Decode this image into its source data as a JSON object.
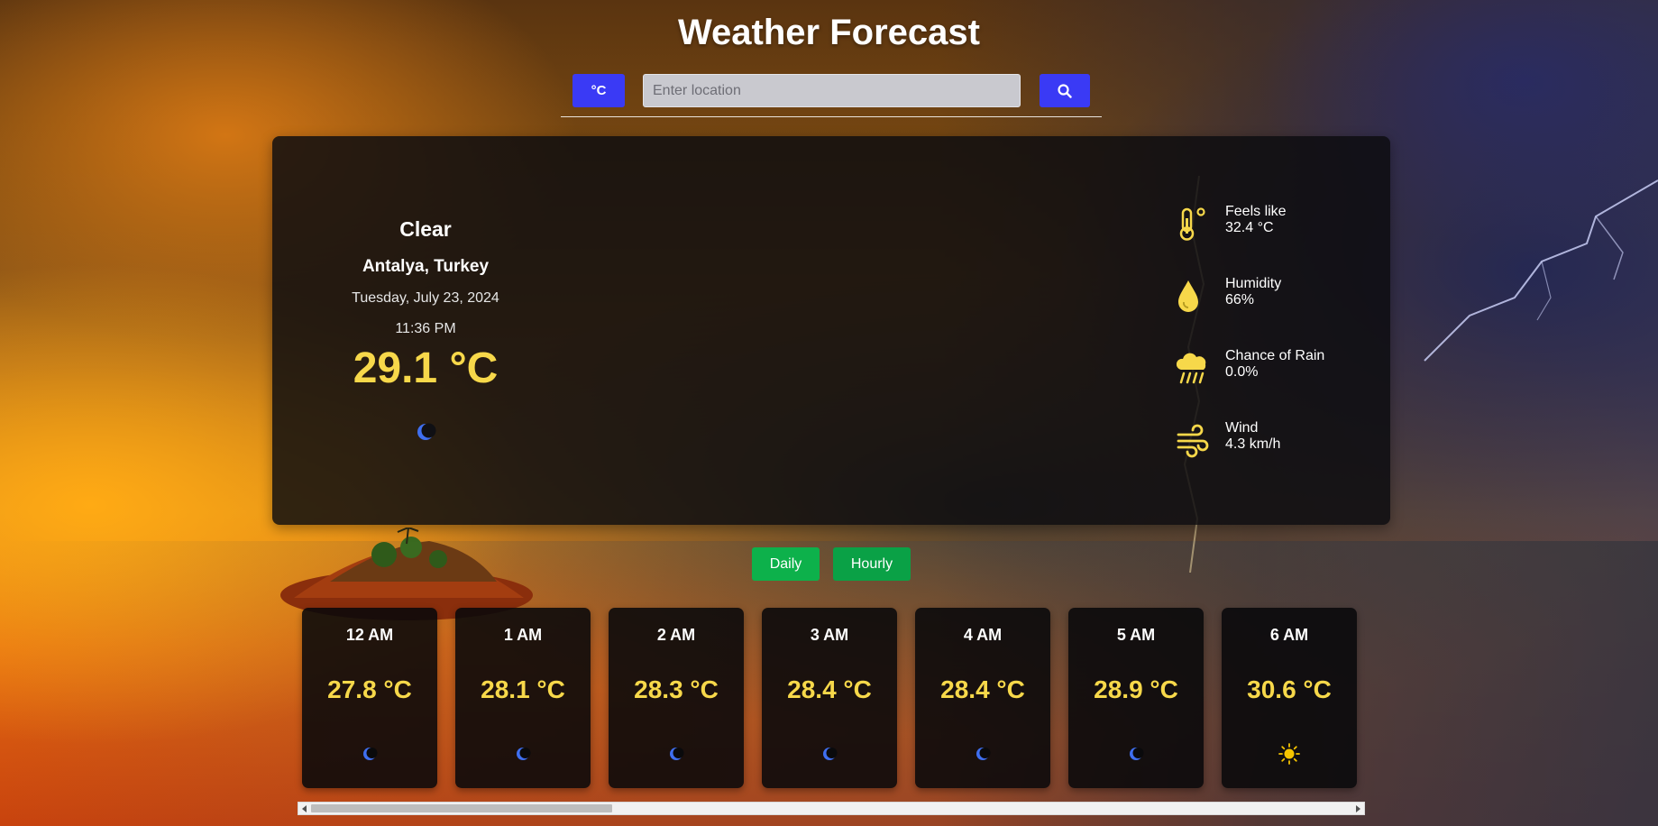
{
  "app": {
    "title": "Weather Forecast"
  },
  "search": {
    "unit_label": "°C",
    "placeholder": "Enter location",
    "value": "",
    "button_icon": "search-icon",
    "accent_color": "#3a3af5"
  },
  "current": {
    "condition": "Clear",
    "location": "Antalya, Turkey",
    "date": "Tuesday, July 23, 2024",
    "time": "11:36 PM",
    "temperature": "29.1 °C",
    "icon": "moon-icon"
  },
  "details": [
    {
      "label": "Feels like",
      "value": "32.4 °C",
      "icon": "thermometer-icon"
    },
    {
      "label": "Humidity",
      "value": "66%",
      "icon": "droplet-icon"
    },
    {
      "label": "Chance of Rain",
      "value": "0.0%",
      "icon": "rain-cloud-icon"
    },
    {
      "label": "Wind",
      "value": "4.3 km/h",
      "icon": "wind-icon"
    }
  ],
  "forecast_toggle": {
    "daily_label": "Daily",
    "hourly_label": "Hourly",
    "color": "#0db14b"
  },
  "hourly": [
    {
      "time": "12 AM",
      "temp": "27.8 °C",
      "icon": "moon-icon"
    },
    {
      "time": "1 AM",
      "temp": "28.1 °C",
      "icon": "moon-icon"
    },
    {
      "time": "2 AM",
      "temp": "28.3 °C",
      "icon": "moon-icon"
    },
    {
      "time": "3 AM",
      "temp": "28.4 °C",
      "icon": "moon-icon"
    },
    {
      "time": "4 AM",
      "temp": "28.4 °C",
      "icon": "moon-icon"
    },
    {
      "time": "5 AM",
      "temp": "28.9 °C",
      "icon": "moon-icon"
    },
    {
      "time": "6 AM",
      "temp": "30.6 °C",
      "icon": "sun-icon"
    }
  ],
  "colors": {
    "temperature": "#f7d84a",
    "detail_icon": "#f7d84a",
    "moon_icon": "#3f6ff0",
    "sun_icon": "#f5c400"
  }
}
